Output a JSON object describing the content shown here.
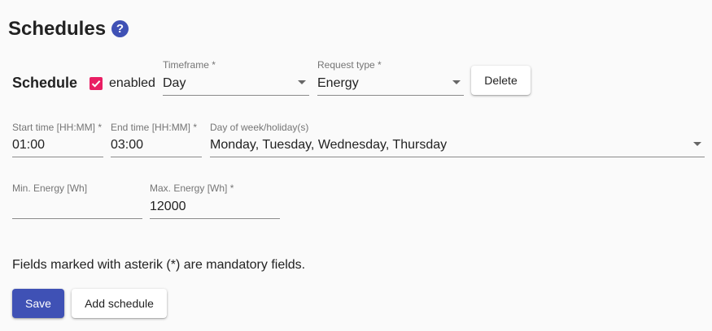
{
  "page": {
    "title": "Schedules",
    "help_icon": "?"
  },
  "schedule": {
    "label": "Schedule",
    "enabled_checked": true,
    "enabled_label": "enabled",
    "timeframe": {
      "label": "Timeframe *",
      "value": "Day"
    },
    "request_type": {
      "label": "Request type *",
      "value": "Energy"
    },
    "delete_label": "Delete",
    "start_time": {
      "label": "Start time [HH:MM] *",
      "value": "01:00"
    },
    "end_time": {
      "label": "End time [HH:MM] *",
      "value": "03:00"
    },
    "day_of_week": {
      "label": "Day of week/holiday(s)",
      "value": "Monday, Tuesday, Wednesday, Thursday"
    },
    "min_energy": {
      "label": "Min. Energy [Wh]",
      "value": ""
    },
    "max_energy": {
      "label": "Max. Energy [Wh] *",
      "value": "12000"
    }
  },
  "note": "Fields marked with asterik (*) are mandatory fields.",
  "actions": {
    "save_label": "Save",
    "add_schedule_label": "Add schedule"
  },
  "colors": {
    "primary": "#3f51b5",
    "checkbox": "#e91e63"
  },
  "icons": {
    "help": "help-icon",
    "checkbox": "check-icon",
    "dropdown": "chevron-down-icon"
  }
}
